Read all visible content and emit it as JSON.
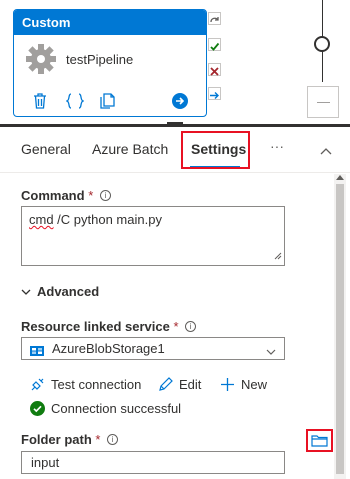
{
  "canvas": {
    "activity": {
      "type_label": "Custom",
      "name": "testPipeline",
      "icons": [
        "delete-icon",
        "code-icon",
        "copy-icon",
        "arrow-right-icon"
      ]
    },
    "side_icons": [
      "redo-icon",
      "check-icon",
      "x-icon",
      "arrow-icon"
    ]
  },
  "tabs": {
    "items": [
      "General",
      "Azure Batch",
      "Settings",
      "···"
    ],
    "active": "Settings"
  },
  "settings": {
    "command_label": "Command",
    "required_mark": "*",
    "info_glyph": "i",
    "command_word": "cmd",
    "command_rest": " /C python main.py",
    "advanced_label": "Advanced",
    "linked_service_label": "Resource linked service",
    "linked_service_value": "AzureBlobStorage1",
    "test_connection": "Test connection",
    "edit": "Edit",
    "new": "New",
    "connection_status": "Connection successful",
    "folder_path_label": "Folder path",
    "folder_path_value": "input"
  },
  "colors": {
    "accent": "#0078d4",
    "highlight": "#e81123",
    "success": "#107c10",
    "required": "#a4262c"
  }
}
